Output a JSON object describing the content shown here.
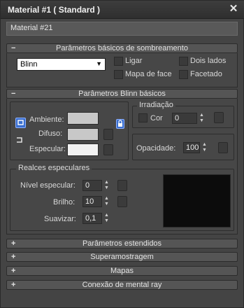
{
  "window": {
    "title": "Material #1  ( Standard )",
    "close_glyph": "✕",
    "material_name": "Material #21"
  },
  "shader_basic": {
    "sign": "−",
    "title": "Parâmetros básicos de sombreamento",
    "shader": "Blinn",
    "dropdown_arrow": "▼",
    "options": [
      {
        "label": "Ligar",
        "checked": false
      },
      {
        "label": "Dois lados",
        "checked": false
      },
      {
        "label": "Mapa de face",
        "checked": false
      },
      {
        "label": "Facetado",
        "checked": false
      }
    ]
  },
  "blinn_basic": {
    "sign": "−",
    "title": "Parâmetros Blinn básicos",
    "ambient_label": "Ambiente:",
    "diffuse_label": "Difuso:",
    "specular_label": "Especular:",
    "ambient_color": "#c8c8c8",
    "diffuse_color": "#c8c8c8",
    "specular_color": "#f2f2f2",
    "self_illum": {
      "title": "Irradiação",
      "color_label": "Cor",
      "color_checked": false,
      "value": "0"
    },
    "opacity": {
      "label": "Opacidade:",
      "value": "100"
    },
    "spec_highlights": {
      "title": "Realces especulares",
      "level_label": "Nível especular:",
      "level_value": "0",
      "gloss_label": "Brilho:",
      "gloss_value": "10",
      "soften_label": "Suavizar:",
      "soften_value": "0,1",
      "curve_bg": "#0c0c0c"
    },
    "spinner_up": "▲",
    "spinner_down": "▼"
  },
  "collapsed_rollouts": [
    {
      "sign": "+",
      "title": "Parâmetros estendidos"
    },
    {
      "sign": "+",
      "title": "Superamostragem"
    },
    {
      "sign": "+",
      "title": "Mapas"
    },
    {
      "sign": "+",
      "title": "Conexão de mental ray"
    }
  ],
  "icons": {
    "ambient_lock": "lock-ambient-diffuse-icon",
    "diffuse_lock": "lock-diffuse-specular-icon",
    "padlock": "padlock-icon"
  }
}
